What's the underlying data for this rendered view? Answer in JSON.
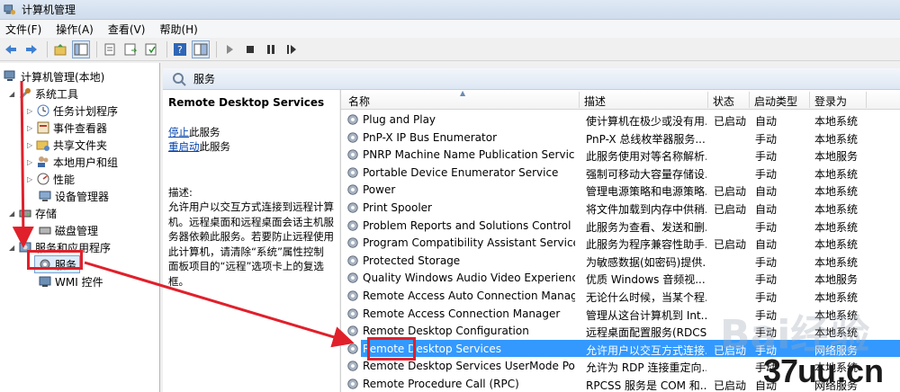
{
  "window": {
    "title": "计算机管理"
  },
  "menu": [
    "文件(F)",
    "操作(A)",
    "查看(V)",
    "帮助(H)"
  ],
  "toolbar_icons": [
    "back-icon",
    "forward-icon",
    "up-folder-icon",
    "show-tree-icon",
    "properties-icon",
    "export-icon",
    "refresh-icon",
    "help-icon",
    "view-icon",
    "play-icon",
    "stop-icon",
    "pause-icon",
    "restart-icon"
  ],
  "tree": {
    "root": "计算机管理(本地)",
    "system_tools": "系统工具",
    "task_scheduler": "任务计划程序",
    "event_viewer": "事件查看器",
    "shared_folders": "共享文件夹",
    "local_users": "本地用户和组",
    "performance": "性能",
    "device_manager": "设备管理器",
    "storage": "存储",
    "disk_management": "磁盘管理",
    "services_apps": "服务和应用程序",
    "services": "服务",
    "wmi": "WMI 控件"
  },
  "detail": {
    "header": "服务",
    "service_title": "Remote Desktop Services",
    "stop_link": "停止",
    "stop_suffix": "此服务",
    "restart_link": "重启动",
    "restart_suffix": "此服务",
    "desc_label": "描述:",
    "desc_text": "允许用户以交互方式连接到远程计算机。远程桌面和远程桌面会话主机服务器依赖此服务。若要防止远程使用此计算机，请清除“系统”属性控制面板项目的“远程”选项卡上的复选框。"
  },
  "columns": {
    "name": "名称",
    "description": "描述",
    "status": "状态",
    "startup": "启动类型",
    "logon": "登录为"
  },
  "services": [
    {
      "name": "Plug and Play",
      "description": "使计算机在极少或没有用...",
      "status": "已启动",
      "startup": "自动",
      "logon": "本地系统"
    },
    {
      "name": "PnP-X IP Bus Enumerator",
      "description": "PnP-X 总线枚举器服务...",
      "status": "",
      "startup": "手动",
      "logon": "本地系统"
    },
    {
      "name": "PNRP Machine Name Publication Service",
      "description": "此服务使用对等名称解析...",
      "status": "",
      "startup": "手动",
      "logon": "本地服务"
    },
    {
      "name": "Portable Device Enumerator Service",
      "description": "强制可移动大容量存储设...",
      "status": "",
      "startup": "手动",
      "logon": "本地系统"
    },
    {
      "name": "Power",
      "description": "管理电源策略和电源策略...",
      "status": "已启动",
      "startup": "自动",
      "logon": "本地系统"
    },
    {
      "name": "Print Spooler",
      "description": "将文件加载到内存中供稍...",
      "status": "已启动",
      "startup": "自动",
      "logon": "本地系统"
    },
    {
      "name": "Problem Reports and Solutions Control Pa...",
      "description": "此服务为查看、发送和删...",
      "status": "",
      "startup": "手动",
      "logon": "本地系统"
    },
    {
      "name": "Program Compatibility Assistant Service",
      "description": "此服务为程序兼容性助手...",
      "status": "已启动",
      "startup": "自动",
      "logon": "本地系统"
    },
    {
      "name": "Protected Storage",
      "description": "为敏感数据(如密码)提供...",
      "status": "",
      "startup": "手动",
      "logon": "本地系统"
    },
    {
      "name": "Quality Windows Audio Video Experience",
      "description": "优质 Windows 音频视...",
      "status": "",
      "startup": "手动",
      "logon": "本地服务"
    },
    {
      "name": "Remote Access Auto Connection Manager",
      "description": "无论什么时候，当某个程...",
      "status": "",
      "startup": "手动",
      "logon": "本地系统"
    },
    {
      "name": "Remote Access Connection Manager",
      "description": "管理从这台计算机到 Int...",
      "status": "",
      "startup": "手动",
      "logon": "本地系统"
    },
    {
      "name": "Remote Desktop Configuration",
      "description": "远程桌面配置服务(RDCS...",
      "status": "",
      "startup": "手动",
      "logon": "本地系统"
    },
    {
      "name": "Remote Desktop Services",
      "description": "允许用户以交互方式连接...",
      "status": "已启动",
      "startup": "手动",
      "logon": "网络服务"
    },
    {
      "name": "Remote Desktop Services UserMode Port ...",
      "description": "允许为 RDP 连接重定向...",
      "status": "",
      "startup": "手动",
      "logon": "本地系统"
    },
    {
      "name": "Remote Procedure Call (RPC)",
      "description": "RPCSS 服务是 COM 和...",
      "status": "已启动",
      "startup": "自动",
      "logon": "网络服务"
    }
  ],
  "selected_row": 13,
  "watermark": {
    "part1": "37uu",
    "part2": ".cn"
  },
  "colors": {
    "selection": "#3399ff",
    "annotation_red": "#e0202b",
    "link": "#0645ad"
  }
}
